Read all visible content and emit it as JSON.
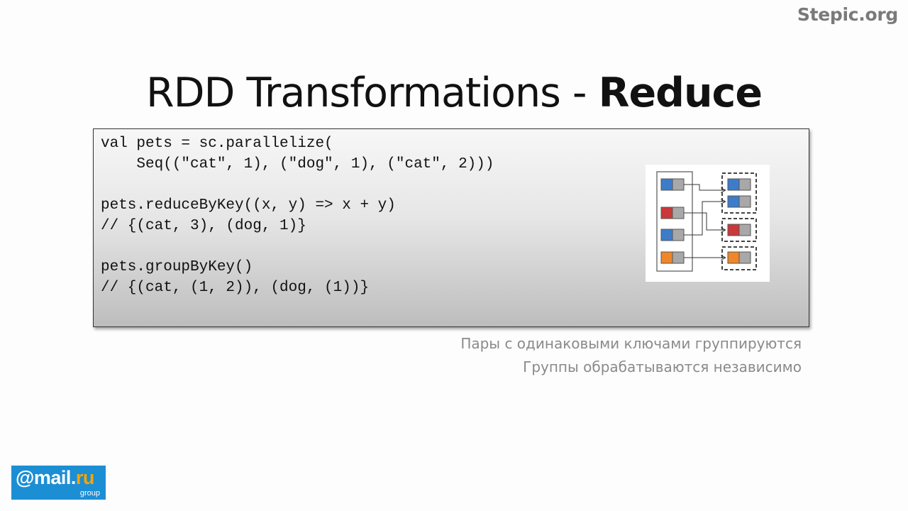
{
  "watermark": "Stepic.org",
  "title": {
    "main": "RDD Transformations - ",
    "emphasis": "Reduce"
  },
  "code": {
    "lines": [
      "val pets = sc.parallelize(",
      "    Seq((\"cat\", 1), (\"dog\", 1), (\"cat\", 2)))",
      "",
      "pets.reduceByKey((x, y) => x + y)",
      "// {(cat, 3), (dog, 1)}",
      "",
      "pets.groupByKey()",
      "// {(cat, (1, 2)), (dog, (1))}"
    ]
  },
  "diagram": {
    "colors": {
      "blue": "#3d7cc9",
      "red": "#c9383a",
      "orange": "#f0862a",
      "gray": "#a8a8a8"
    }
  },
  "captions": [
    "Пары с одинаковыми ключами группируются",
    "Группы обрабатываются независимо"
  ],
  "logo": {
    "main_prefix": "@mail.",
    "main_suffix": "ru",
    "sub": "group"
  }
}
